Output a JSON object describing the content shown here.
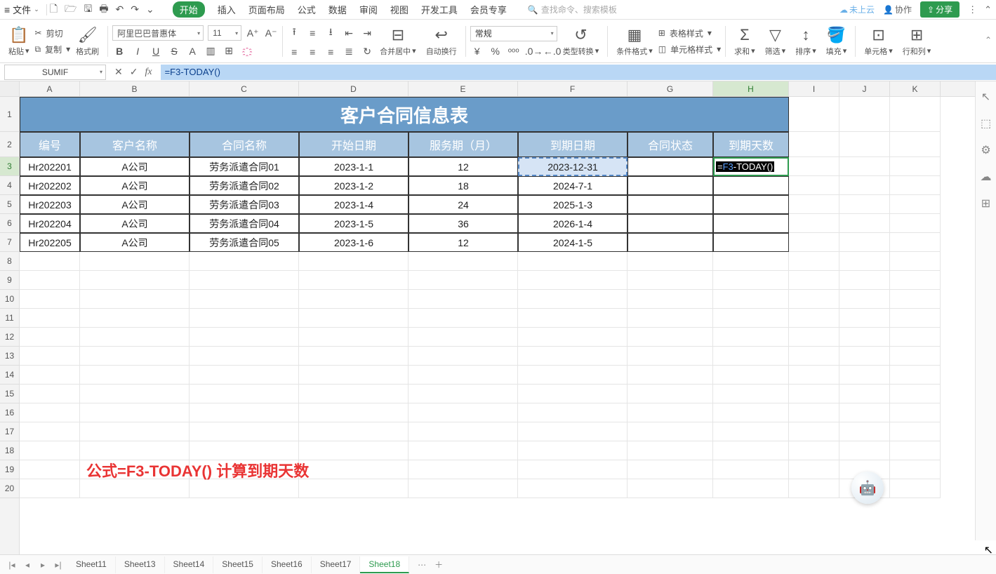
{
  "menubar": {
    "file": "文件",
    "tabs": [
      "开始",
      "插入",
      "页面布局",
      "公式",
      "数据",
      "审阅",
      "视图",
      "开发工具",
      "会员专享"
    ],
    "search_placeholder": "查找命令、搜索模板",
    "cloud": "未上云",
    "collab": "协作",
    "share": "分享"
  },
  "ribbon": {
    "paste": "粘贴",
    "cut": "剪切",
    "copy": "复制",
    "format_painter": "格式刷",
    "font_name": "阿里巴巴普惠体",
    "font_size": "11",
    "merge": "合并居中",
    "wrap": "自动换行",
    "number_format": "常规",
    "type_convert": "类型转换",
    "cond_format": "条件格式",
    "table_style": "表格样式",
    "cell_style": "单元格样式",
    "sum": "求和",
    "filter": "筛选",
    "sort": "排序",
    "fill": "填充",
    "cells": "单元格",
    "rowcol": "行和列"
  },
  "formula_bar": {
    "name_box": "SUMIF",
    "formula": "=F3-TODAY()"
  },
  "columns": [
    "A",
    "B",
    "C",
    "D",
    "E",
    "F",
    "G",
    "H",
    "I",
    "J",
    "K"
  ],
  "row_nums": [
    "1",
    "2",
    "3",
    "4",
    "5",
    "6",
    "7",
    "8",
    "9",
    "10",
    "11",
    "12",
    "13",
    "14",
    "15",
    "16",
    "17",
    "18",
    "19",
    "20"
  ],
  "sheet": {
    "title": "客户合同信息表",
    "headers": [
      "编号",
      "客户名称",
      "合同名称",
      "开始日期",
      "服务期（月）",
      "到期日期",
      "合同状态",
      "到期天数"
    ],
    "rows": [
      {
        "id": "Hr202201",
        "cust": "A公司",
        "name": "劳务派遣合同01",
        "start": "2023-1-1",
        "months": "12",
        "due": "2023-12-31",
        "status": "",
        "days": "=F3 -TODAY()"
      },
      {
        "id": "Hr202202",
        "cust": "A公司",
        "name": "劳务派遣合同02",
        "start": "2023-1-2",
        "months": "18",
        "due": "2024-7-1",
        "status": "",
        "days": ""
      },
      {
        "id": "Hr202203",
        "cust": "A公司",
        "name": "劳务派遣合同03",
        "start": "2023-1-4",
        "months": "24",
        "due": "2025-1-3",
        "status": "",
        "days": ""
      },
      {
        "id": "Hr202204",
        "cust": "A公司",
        "name": "劳务派遣合同04",
        "start": "2023-1-5",
        "months": "36",
        "due": "2026-1-4",
        "status": "",
        "days": ""
      },
      {
        "id": "Hr202205",
        "cust": "A公司",
        "name": "劳务派遣合同05",
        "start": "2023-1-6",
        "months": "12",
        "due": "2024-1-5",
        "status": "",
        "days": ""
      }
    ]
  },
  "annotation": "公式=F3-TODAY() 计算到期天数",
  "sheet_tabs": [
    "Sheet11",
    "Sheet13",
    "Sheet14",
    "Sheet15",
    "Sheet16",
    "Sheet17",
    "Sheet18"
  ],
  "active_sheet": "Sheet18",
  "active_cell_formula": {
    "prefix": "=",
    "ref": "F3",
    "rest": " -TODAY()"
  }
}
